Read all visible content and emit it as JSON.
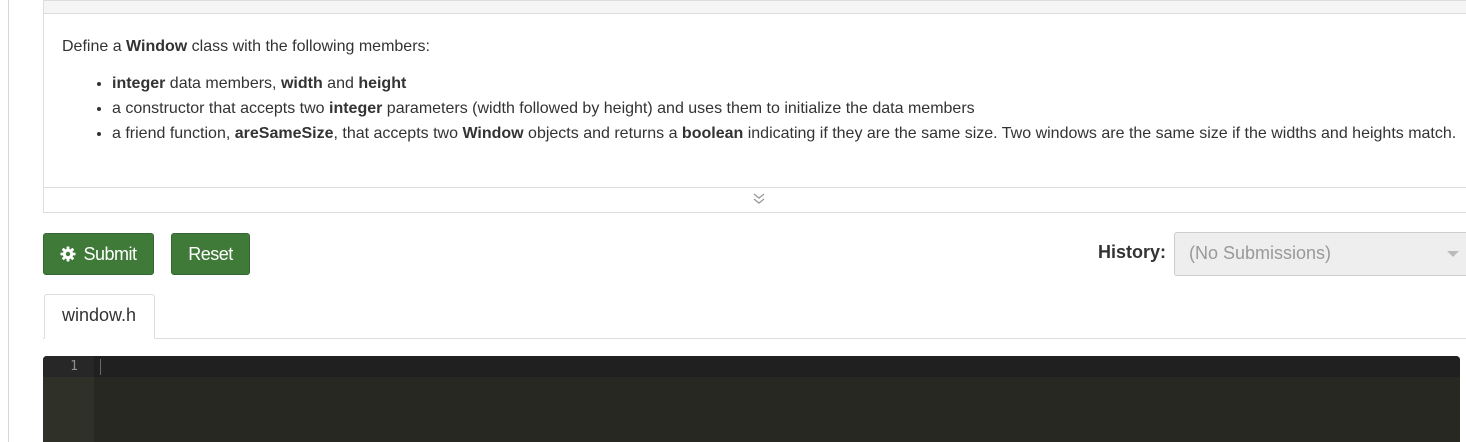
{
  "description": {
    "intro": {
      "pre": "Define a ",
      "class_name": "Window",
      "post": " class with the following members:"
    },
    "items": [
      {
        "b1": "integer",
        "t1": " data members, ",
        "b2": "width",
        "t2": " and ",
        "b3": "height"
      },
      {
        "t1": "a constructor that accepts two ",
        "b1": "integer",
        "t2": " parameters (width followed by height) and uses them to initialize the data members"
      },
      {
        "t1": "a friend function, ",
        "b1": "areSameSize",
        "t2": ", that accepts two ",
        "b2": "Window",
        "t3": " objects and returns a ",
        "b3": "boolean",
        "t4": " indicating if they are the same size. Two windows are the same size if the widths and heights match."
      }
    ]
  },
  "actions": {
    "submit_label": "Submit",
    "reset_label": "Reset"
  },
  "history": {
    "label": "History:",
    "selected": "(No Submissions)"
  },
  "files": {
    "tabs": [
      "window.h"
    ]
  },
  "editor": {
    "line_numbers": [
      "1"
    ],
    "content": ""
  },
  "colors": {
    "button": "#3f7a38",
    "editor_bg": "#272822",
    "gutter_bg": "#2f3129"
  },
  "icons": {
    "submit": "gear-icon",
    "expand": "double-chevron-down-icon",
    "history": "caret-down-icon"
  }
}
